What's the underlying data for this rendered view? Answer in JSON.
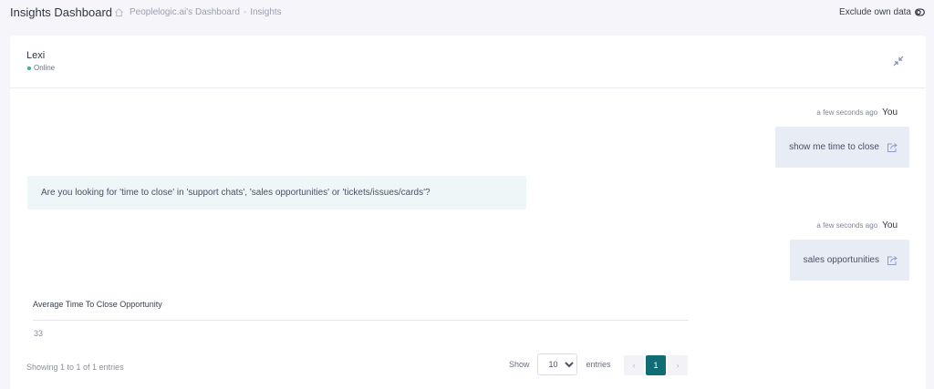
{
  "header": {
    "title": "Insights Dashboard",
    "breadcrumb": {
      "home_icon": "home-icon",
      "dashboard": "Peoplelogic.ai's Dashboard",
      "separator": "-",
      "current": "Insights"
    },
    "exclude_label": "Exclude own data",
    "exclude_icon": "toggle-icon"
  },
  "chat": {
    "agent_name": "Lexi",
    "agent_status": "Online",
    "status_color": "#2fb596",
    "collapse_icon": "collapse-icon",
    "messages": [
      {
        "from": "user",
        "time": "a few seconds ago",
        "author": "You",
        "text": "show me time to close",
        "icon": "share-icon"
      },
      {
        "from": "bot",
        "text": "Are you looking for 'time to close' in 'support chats', 'sales opportunities' or 'tickets/issues/cards'?"
      },
      {
        "from": "user",
        "time": "a few seconds ago",
        "author": "You",
        "text": "sales opportunities",
        "icon": "share-icon"
      }
    ],
    "result": {
      "column": "Average Time To Close Opportunity",
      "value": "33",
      "showing": "Showing 1 to 1 of 1 entries",
      "show_label": "Show",
      "entries_label": "entries",
      "page_size": "10",
      "page_size_options": [
        "10"
      ],
      "pages": {
        "prev": "‹",
        "current": "1",
        "next": "›"
      },
      "accent": "#0f6d73"
    }
  }
}
